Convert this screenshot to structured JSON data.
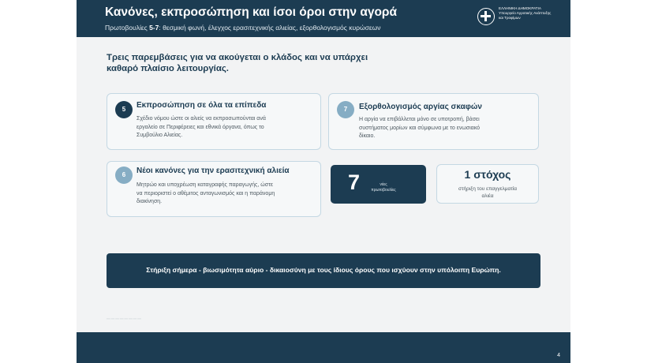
{
  "header": {
    "title": "Κανόνες, εκπροσώπηση και ίσοι όροι στην αγορά",
    "subtitle_prefix": "Πρωτοβουλίες",
    "subtitle_range": "5-7",
    "subtitle_text": ": θεσμική φωνή, έλεγχος ερασιτεχνικής αλιείας, εξορθολογισμός κυρώσεων",
    "logo_lines": [
      "ΕΛΛΗΝΙΚΗ ΔΗΜΟΚΡΑΤΙΑ",
      "Υπουργείο Αγροτικής Ανάπτυξης",
      "και Τροφίμων"
    ]
  },
  "intro": {
    "line1": "Τρεις παρεμβάσεις για να ακούγεται ο κλάδος και να υπάρχει",
    "line2": "καθαρό πλαίσιο λειτουργίας."
  },
  "cards": [
    {
      "number": "5",
      "title": "Εκπροσώπηση σε όλα τα επίπεδα",
      "lines": [
        "Σχέδιο νόμου ώστε οι αλιείς να εκπροσωπούνται ανά",
        "εργαλείο σε Περιφέρειες και εθνικά όργανα, όπως το",
        "Συμβούλιο Αλιείας."
      ]
    },
    {
      "number": "7",
      "title": "Εξορθολογισμός αργίας σκαφών",
      "lines": [
        "Η αργία να επιβάλλεται μόνο σε υποτροπή, βάσει",
        "συστήματος μορίων και σύμφωνα με το ενωσιακό",
        "δίκαιο."
      ]
    },
    {
      "number": "6",
      "title": "Νέοι κανόνες για την ερασιτεχνική αλιεία",
      "lines": [
        "Μητρώο και υποχρέωση καταγραφής παραγωγής, ώστε",
        "να περιοριστεί ο αθέμιτος ανταγωνισμός και η παράνομη",
        "διακίνηση."
      ]
    }
  ],
  "stats": {
    "initiatives_number": "7",
    "initiatives_label_1": "νέες",
    "initiatives_label_2": "πρωτοβουλίες",
    "goal_number": "1 στόχος",
    "goal_label_1": "στήριξη του επαγγελματία",
    "goal_label_2": "αλιέα"
  },
  "banner": {
    "text": "Στήριξη σήμερα - βιωσιμότητα αύριο - δικαιοσύνη με τους ίδιους όρους που ισχύουν στην υπόλοιπη Ευρώπη."
  },
  "footer": {
    "page_number": "4"
  },
  "colors": {
    "navy": "#1c3c52",
    "card_border": "#c4d8e3",
    "light_badge": "#86adc4",
    "background": "#f2f3f4"
  }
}
